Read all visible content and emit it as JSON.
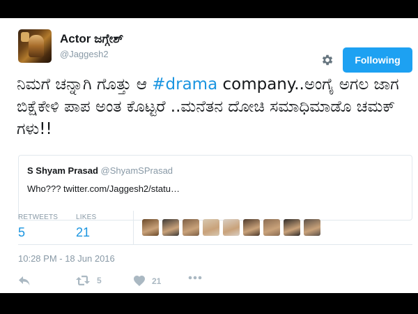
{
  "profile": {
    "name": "Actor ಜಗ್ಗೇಶ್",
    "handle": "@Jaggesh2"
  },
  "header": {
    "follow_label": "Following",
    "settings_icon": "gear-icon"
  },
  "tweet": {
    "text_before": "ನಿಮಗೆ ಚನ್ನಾಗಿ ಗೊತ್ತು ಆ ",
    "hashtag": "#drama",
    "text_after": " company..ಅಂಗೈ ಅಗಲ ಜಾಗ ಬಿಕ್ಷೆಕೇಳಿ ಪಾಪ ಅಂತ ಕೊಟ್ಟರೆ ..ಮನೆತನ ದೋಚಿ ಸಮಾಧಿಮಾಡೊ ಚಮಕ್ ಗಳು!!"
  },
  "quote": {
    "name": "S Shyam Prasad",
    "handle": "@ShyamSPrasad",
    "text": "Who??? twitter.com/Jaggesh2/statu…"
  },
  "stats": {
    "retweets_label": "RETWEETS",
    "retweets_count": "5",
    "likes_label": "LIKES",
    "likes_count": "21"
  },
  "likers": [
    {
      "color": "#6b4a2a"
    },
    {
      "color": "#3e3a36"
    },
    {
      "color": "#7d5f45"
    },
    {
      "color": "#d7c8b0"
    },
    {
      "color": "#d9cfc4"
    },
    {
      "color": "#4e3a2c"
    },
    {
      "color": "#8a6c52"
    },
    {
      "color": "#2f2b28"
    },
    {
      "color": "#5b5048"
    }
  ],
  "timestamp": "10:28 PM - 18 Jun 2016",
  "actions": {
    "reply_icon": "reply-icon",
    "retweet_icon": "retweet-icon",
    "retweet_count": "5",
    "like_icon": "heart-icon",
    "like_count": "21",
    "more_icon": "more-icon"
  },
  "colors": {
    "accent": "#1da1f2",
    "link": "#1b95e0",
    "muted": "#8899a6"
  }
}
